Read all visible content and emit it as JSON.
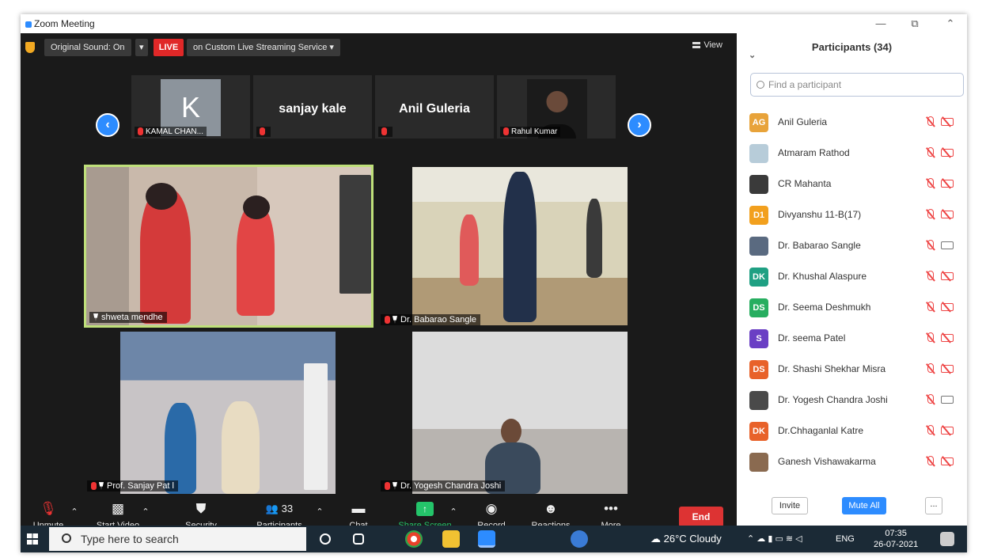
{
  "window": {
    "title": "Zoom Meeting",
    "controls": [
      "—",
      "⧉",
      "⌃"
    ]
  },
  "topbar": {
    "original_sound": "Original Sound: On",
    "live": "LIVE",
    "stream": "on Custom Live Streaming Service",
    "view": "View"
  },
  "strip": [
    {
      "avatar": "K",
      "label": "KAMAL CHAN..."
    },
    {
      "name": "sanjay kale",
      "label": ""
    },
    {
      "name": "Anil Guleria",
      "label": ""
    },
    {
      "label": "Rahul Kumar"
    }
  ],
  "tiles": [
    {
      "name": "shweta mendhe"
    },
    {
      "name": "Dr. Babarao Sangle"
    },
    {
      "name": "Prof. Sanjay Pat l"
    },
    {
      "name": "Dr. Yogesh Chandra Joshi"
    }
  ],
  "toolbar": {
    "unmute": "Unmute",
    "start_video": "Start Video",
    "security": "Security",
    "participants": "Participants",
    "participants_count": "33",
    "chat": "Chat",
    "share_screen": "Share Screen",
    "record": "Record",
    "reactions": "Reactions",
    "more": "More",
    "end": "End"
  },
  "panel": {
    "title": "Participants (34)",
    "search_placeholder": "Find a participant",
    "invite": "Invite",
    "mute_all": "Mute All",
    "more": "...",
    "participants": [
      {
        "initials": "AG",
        "color": "#e8a33a",
        "name": "Anil Guleria",
        "video": "off"
      },
      {
        "initials": "",
        "color": "#b7ccd9",
        "name": "Atmaram Rathod",
        "video": "off"
      },
      {
        "initials": "",
        "color": "#3a3a3a",
        "name": "CR Mahanta",
        "video": "off"
      },
      {
        "initials": "D1",
        "color": "#f2a01e",
        "name": "Divyanshu 11-B(17)",
        "video": "off"
      },
      {
        "initials": "",
        "color": "#5a6a80",
        "name": "Dr. Babarao Sangle",
        "video": "on"
      },
      {
        "initials": "DK",
        "color": "#1fa083",
        "name": "Dr. Khushal Alaspure",
        "video": "off"
      },
      {
        "initials": "DS",
        "color": "#27ae60",
        "name": "Dr. Seema Deshmukh",
        "video": "off"
      },
      {
        "initials": "S",
        "color": "#6a3fc4",
        "name": "Dr. seema Patel",
        "video": "off"
      },
      {
        "initials": "DS",
        "color": "#e8622a",
        "name": "Dr. Shashi Shekhar Misra",
        "video": "off"
      },
      {
        "initials": "",
        "color": "#4a4a4a",
        "name": "Dr. Yogesh Chandra Joshi",
        "video": "on"
      },
      {
        "initials": "DK",
        "color": "#e8622a",
        "name": "Dr.Chhaganlal Katre",
        "video": "off"
      },
      {
        "initials": "",
        "color": "#8a6a50",
        "name": "Ganesh Vishawakarma",
        "video": "off"
      }
    ]
  },
  "taskbar": {
    "search": "Type here to search",
    "weather": "26°C  Cloudy",
    "lang": "ENG",
    "time": "07:35",
    "date": "26-07-2021"
  },
  "colors": {
    "accent": "#2d8cff",
    "live": "#e02828",
    "end": "#dd3333",
    "share": "#24c46a",
    "active_speaker": "#bfe07a"
  }
}
